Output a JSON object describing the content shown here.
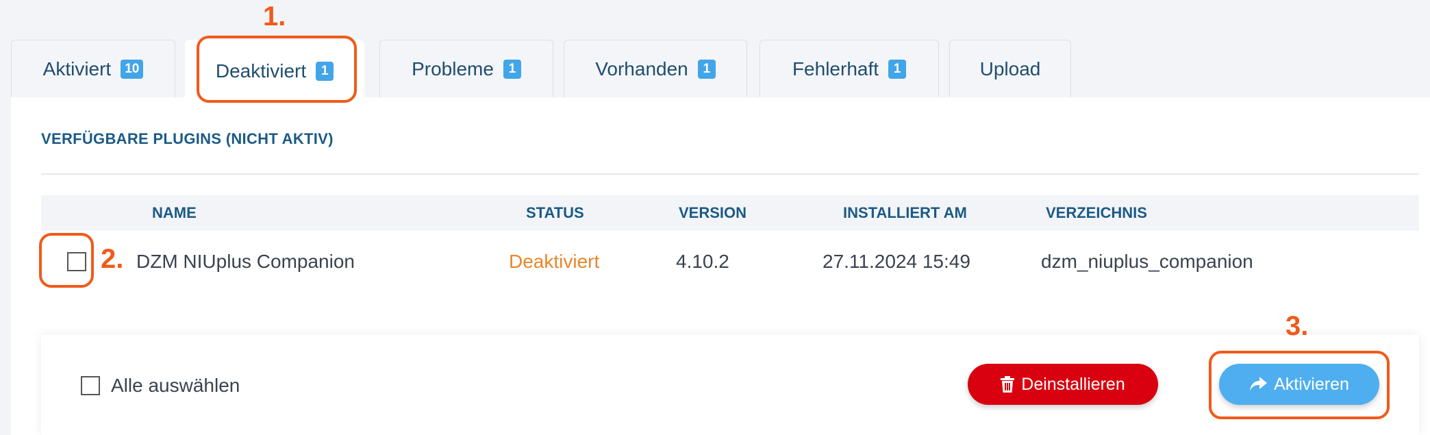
{
  "tabs": [
    {
      "label": "Aktiviert",
      "badge": "10"
    },
    {
      "label": "Deaktiviert",
      "badge": "1"
    },
    {
      "label": "Probleme",
      "badge": "1"
    },
    {
      "label": "Vorhanden",
      "badge": "1"
    },
    {
      "label": "Fehlerhaft",
      "badge": "1"
    },
    {
      "label": "Upload"
    }
  ],
  "section": {
    "title": "VERFÜGBARE PLUGINS (NICHT AKTIV)"
  },
  "table": {
    "headers": {
      "name": "NAME",
      "status": "STATUS",
      "version": "VERSION",
      "installed": "INSTALLIERT AM",
      "directory": "VERZEICHNIS"
    },
    "rows": [
      {
        "name": "DZM NIUplus Companion",
        "status": "Deaktiviert",
        "version": "4.10.2",
        "installed": "27.11.2024 15:49",
        "directory": "dzm_niuplus_companion"
      }
    ]
  },
  "footer": {
    "select_all_label": "Alle auswählen",
    "uninstall_label": "Deinstallieren",
    "activate_label": "Aktivieren"
  },
  "annotations": {
    "step1": "1.",
    "step2": "2.",
    "step3": "3."
  },
  "colors": {
    "accent": "#42a5e8",
    "danger": "#d9000f",
    "primary_button": "#4eaef0",
    "status_deactivated": "#e8862a",
    "annotation": "#f05a1a"
  },
  "icons": {
    "uninstall": "trash-icon",
    "activate": "share-arrow-icon"
  }
}
